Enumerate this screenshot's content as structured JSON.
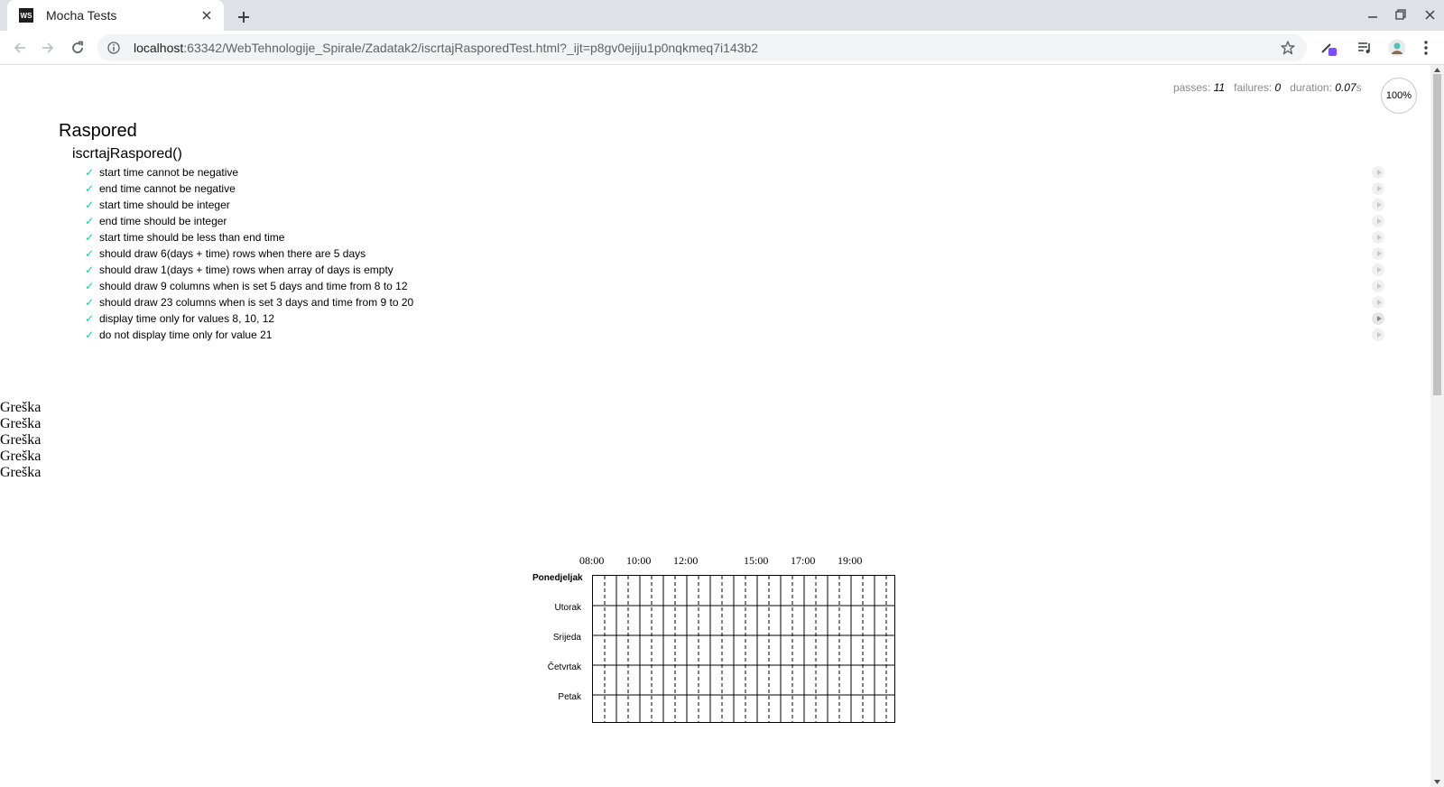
{
  "browser": {
    "tab_title": "Mocha Tests",
    "favicon_text": "WS",
    "url_host": "localhost",
    "url_rest": ":63342/WebTehnologije_Spirale/Zadatak2/iscrtajRasporedTest.html?_ijt=p8gv0ejiju1p0nqkmeq7i143b2"
  },
  "stats": {
    "passes_label": "passes:",
    "passes": "11",
    "failures_label": "failures:",
    "failures": "0",
    "duration_label": "duration:",
    "duration": "0.07",
    "duration_unit": "s",
    "progress": "100%"
  },
  "suite": {
    "title": "Raspored",
    "subtitle": "iscrtajRaspored()",
    "tests": [
      "start time cannot be negative",
      "end time cannot be negative",
      "start time should be integer",
      "end time should be integer",
      "start time should be less than end time",
      "should draw 6(days + time) rows when there are 5 days",
      "should draw 1(days + time) rows when array of days is empty",
      "should draw 9 columns when is set 5 days and time from 8 to 12",
      "should draw 23 columns when is set 3 days and time from 9 to 20",
      "display time only for values 8, 10, 12",
      "do not display time only for value 21"
    ],
    "check": "✓"
  },
  "errors": [
    "Greška",
    "Greška",
    "Greška",
    "Greška",
    "Greška"
  ],
  "schedule": {
    "hours": [
      "08:00",
      "10:00",
      "12:00",
      "15:00",
      "17:00",
      "19:00"
    ],
    "days": [
      "Ponedjeljak",
      "Utorak",
      "Srijeda",
      "Četvrtak",
      "Petak"
    ]
  }
}
